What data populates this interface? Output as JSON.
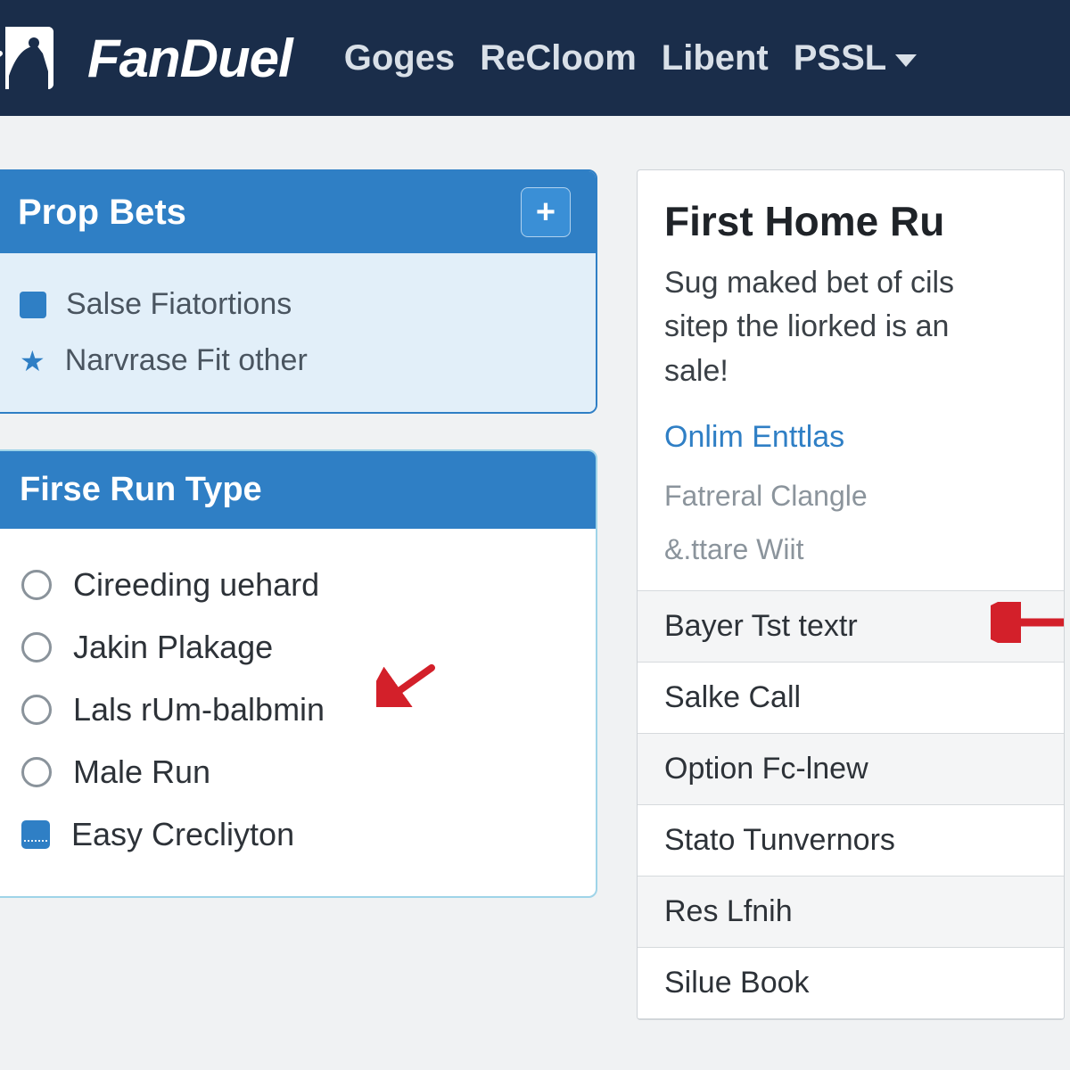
{
  "header": {
    "brand": "FanDuel",
    "nav": [
      "Goges",
      "ReCloom",
      "Libent",
      "PSSL"
    ]
  },
  "propBets": {
    "title": "Prop Bets",
    "items": [
      {
        "icon": "square",
        "label": "Salse Fiatortions"
      },
      {
        "icon": "star",
        "label": "Narvrase Fit other"
      }
    ]
  },
  "runType": {
    "title": "Firse Run Type",
    "options": [
      {
        "kind": "radio",
        "label": "Cireeding uehard"
      },
      {
        "kind": "radio",
        "label": "Jakin Plakage"
      },
      {
        "kind": "radio",
        "label": "Lals rUm-balbmin"
      },
      {
        "kind": "radio",
        "label": "Male Run"
      },
      {
        "kind": "square",
        "label": "Easy Crecliyton"
      }
    ]
  },
  "rightPanel": {
    "title": "First Home Ru",
    "promo_line1": "Sug maked bet of cils",
    "promo_line2": "sitep the liorked is an",
    "promo_line3": "sale!",
    "link": "Onlim Enttlas",
    "sub1": "Fatreral Clangle",
    "sub2": "&.ttare Wiit",
    "list": [
      "Bayer Tst textr",
      "Salke Call",
      "Option Fc-lnew",
      "Stato Tunvernors",
      "Res Lfnih",
      "Silue Book"
    ]
  }
}
